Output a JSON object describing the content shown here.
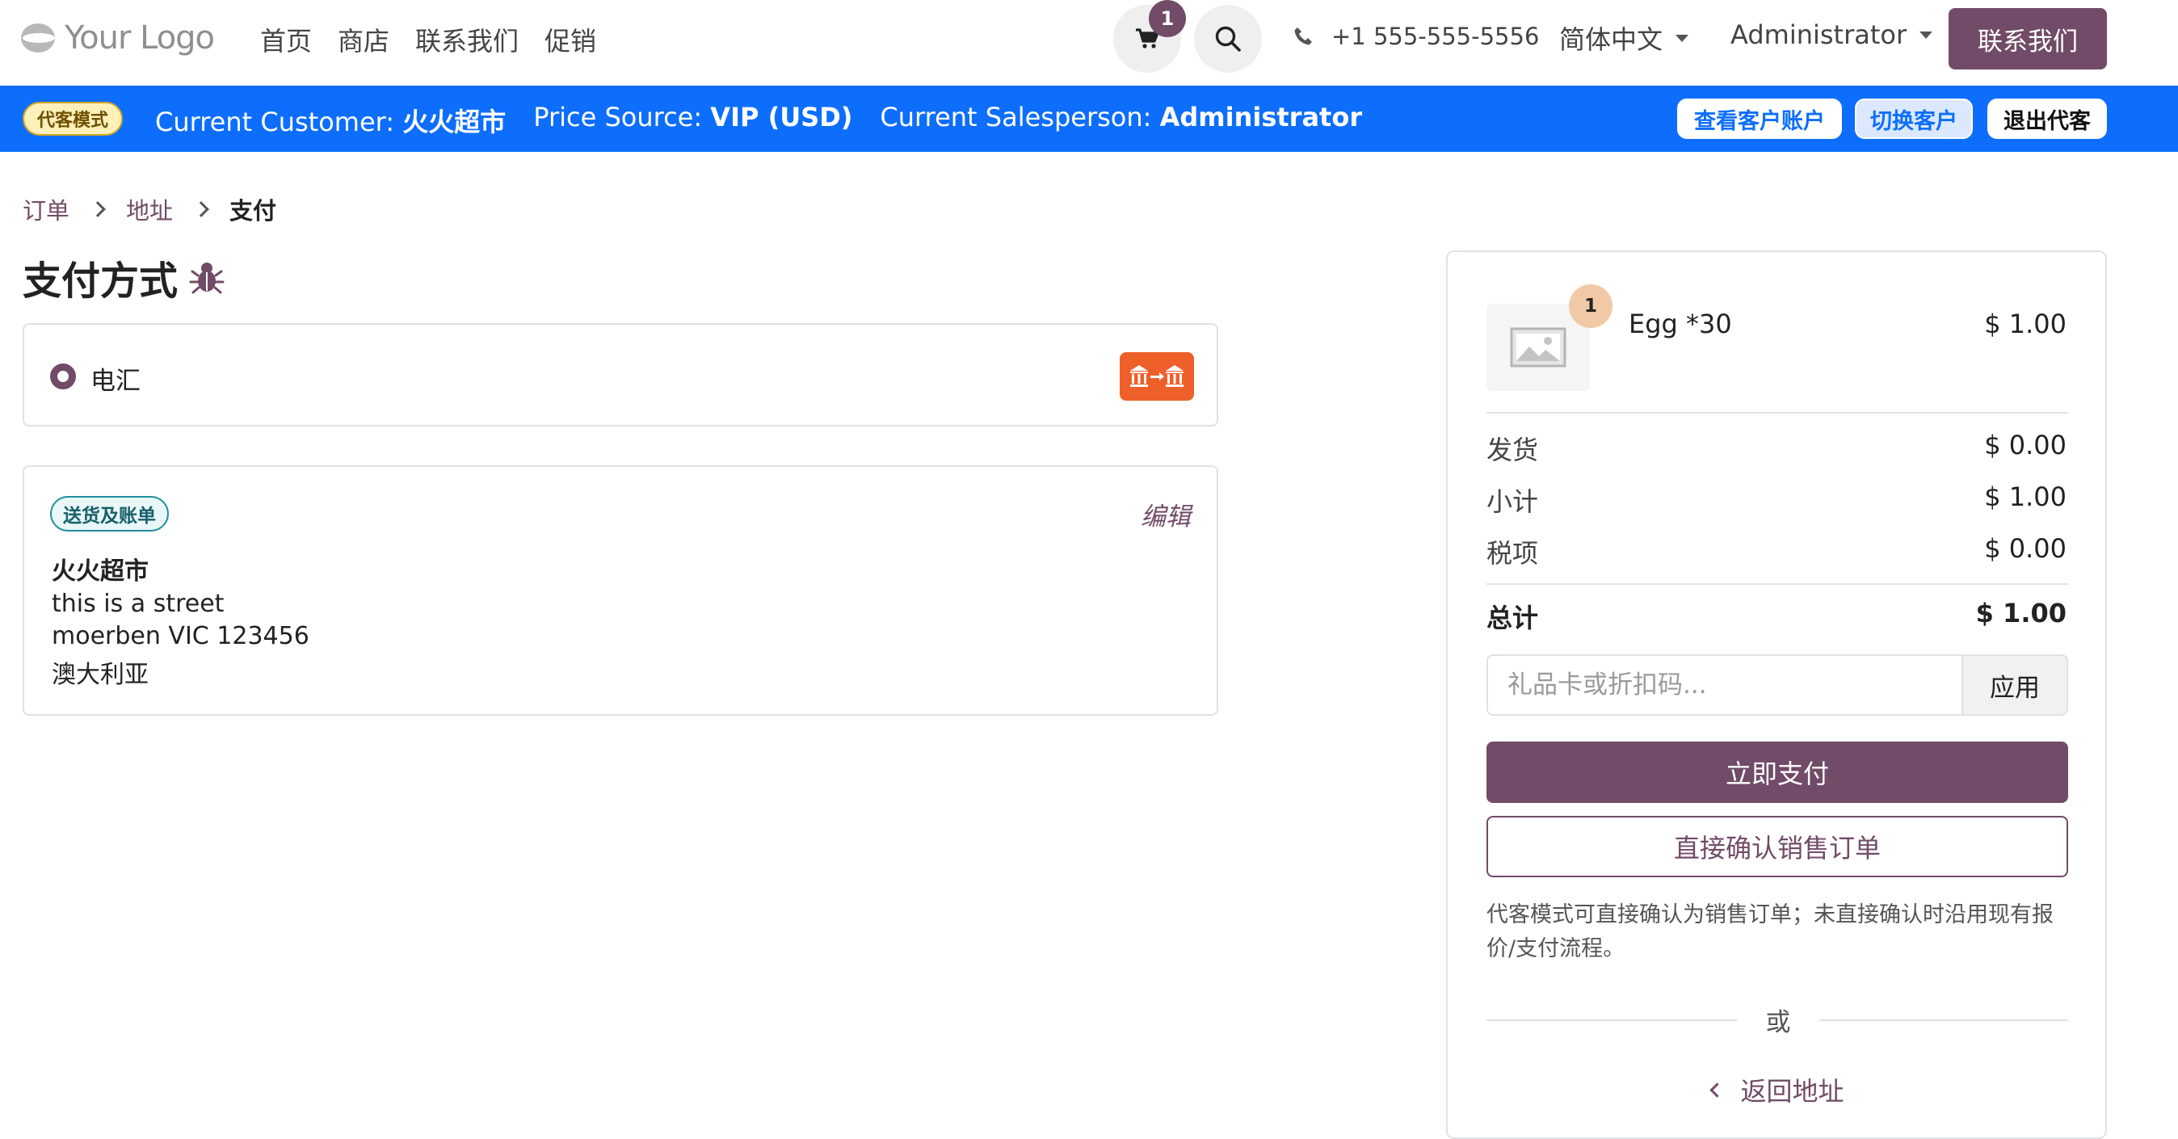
{
  "colors": {
    "brand": "#714b67",
    "agent_bar": "#0d6efd",
    "bank_icon_bg": "#ef5f2a"
  },
  "header": {
    "logo_text": "Your Logo",
    "nav": [
      "首页",
      "商店",
      "联系我们",
      "促销"
    ],
    "cart_count": "1",
    "phone": "+1 555-555-5556",
    "language": "简体中文",
    "user": "Administrator",
    "contact_button": "联系我们"
  },
  "agent_bar": {
    "badge": "代客模式",
    "customer_label": "Current Customer:",
    "customer_value": "火火超市",
    "price_label": "Price Source:",
    "price_value": "VIP (USD)",
    "salesperson_label": "Current Salesperson:",
    "salesperson_value": "Administrator",
    "view_account": "查看客户账户",
    "switch_customer": "切换客户",
    "exit_agent": "退出代客"
  },
  "breadcrumb": [
    "订单",
    "地址",
    "支付"
  ],
  "payment": {
    "title": "支付方式",
    "method_label": "电汇",
    "method_selected": true
  },
  "address": {
    "tag": "送货及账单",
    "edit": "编辑",
    "name": "火火超市",
    "lines": [
      "this is a street",
      "moerben VIC 123456",
      "澳大利亚"
    ]
  },
  "summary": {
    "product": {
      "qty": "1",
      "name": "Egg *30",
      "price": "$ 1.00"
    },
    "rows": [
      {
        "label": "发货",
        "value": "$ 0.00"
      },
      {
        "label": "小计",
        "value": "$ 1.00"
      },
      {
        "label": "税项",
        "value": "$ 0.00"
      }
    ],
    "total_label": "总计",
    "total_value": "$ 1.00",
    "promo_placeholder": "礼品卡或折扣码...",
    "promo_apply": "应用",
    "pay_now": "立即支付",
    "confirm_order": "直接确认销售订单",
    "note": "代客模式可直接确认为销售订单；未直接确认时沿用现有报价/支付流程。",
    "or": "或",
    "back": "返回地址"
  }
}
